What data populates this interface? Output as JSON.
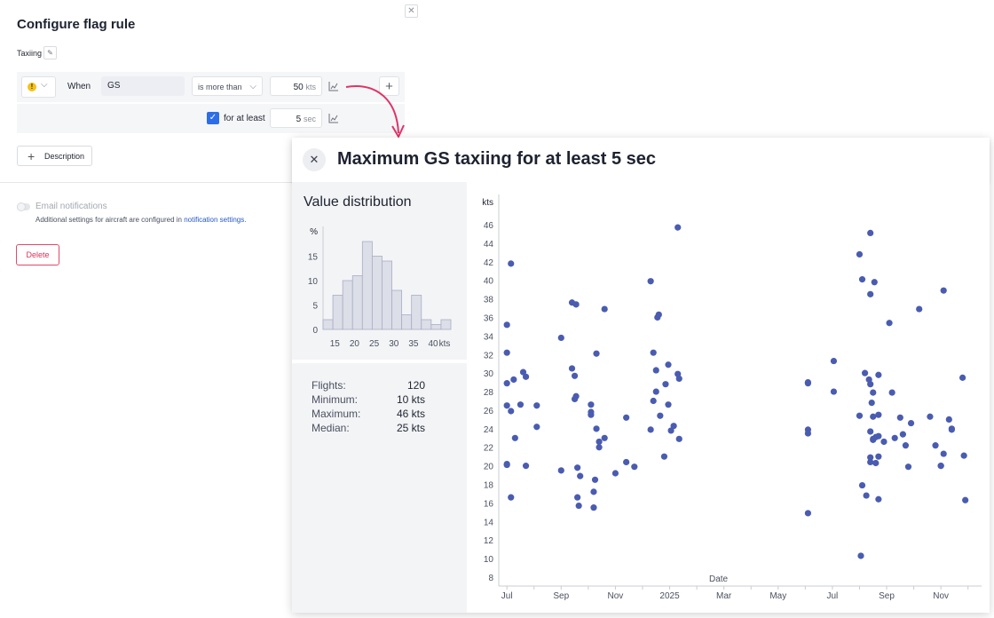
{
  "form": {
    "title": "Configure flag rule",
    "name": "Taxiing",
    "when_label": "When",
    "parameter": "GS",
    "condition": "is more than",
    "threshold_value": "50",
    "threshold_unit": "kts",
    "duration_label": "for at least",
    "duration_value": "5",
    "duration_unit": "sec",
    "description_button": "Description",
    "email_label": "Email notifications",
    "additional_text": "Additional settings for aircraft are configured in ",
    "notification_link": "notification settings.",
    "delete_button": "Delete",
    "accent_color": "#2d6ee6",
    "delete_color": "#d8335a"
  },
  "panel": {
    "title": "Maximum GS taxiing for at least 5 sec",
    "close_icon": "close-icon",
    "distribution_title": "Value distribution",
    "stats": [
      {
        "label": "Flights:",
        "value": "120"
      },
      {
        "label": "Minimum:",
        "value": "10 kts"
      },
      {
        "label": "Maximum:",
        "value": "46 kts"
      },
      {
        "label": "Median:",
        "value": "25 kts"
      }
    ]
  },
  "chart_data": [
    {
      "type": "bar",
      "ylabel": "%",
      "xlabel": "kts",
      "x_ticks": [
        "15",
        "20",
        "25",
        "30",
        "35",
        "40"
      ],
      "y_ticks": [
        0,
        5,
        10,
        15
      ],
      "ylim": [
        0,
        20
      ],
      "bins": [
        {
          "from": 12,
          "to": 14.5,
          "value": 2
        },
        {
          "from": 14.5,
          "to": 17,
          "value": 7
        },
        {
          "from": 17,
          "to": 19.5,
          "value": 10
        },
        {
          "from": 19.5,
          "to": 22,
          "value": 11
        },
        {
          "from": 22,
          "to": 24.5,
          "value": 18
        },
        {
          "from": 24.5,
          "to": 27,
          "value": 15
        },
        {
          "from": 27,
          "to": 29.5,
          "value": 14
        },
        {
          "from": 29.5,
          "to": 32,
          "value": 8
        },
        {
          "from": 32,
          "to": 34.5,
          "value": 3
        },
        {
          "from": 34.5,
          "to": 37,
          "value": 7
        },
        {
          "from": 37,
          "to": 39.5,
          "value": 2
        },
        {
          "from": 39.5,
          "to": 42,
          "value": 1
        },
        {
          "from": 42,
          "to": 44.5,
          "value": 2
        }
      ],
      "bar_color": "#dcdee8",
      "bar_stroke": "#a9adc4"
    },
    {
      "type": "scatter",
      "ylabel": "kts",
      "xlabel": "Date",
      "ylim": [
        8,
        46
      ],
      "y_ticks": [
        8,
        10,
        12,
        14,
        16,
        18,
        20,
        22,
        24,
        26,
        28,
        30,
        32,
        34,
        36,
        38,
        40,
        42,
        44,
        46
      ],
      "x_ticks": [
        "Jul",
        "Sep",
        "Nov",
        "2025",
        "Mar",
        "May",
        "Jul",
        "Sep",
        "Nov"
      ],
      "x_tick_months": [
        0,
        2,
        4,
        6,
        8,
        10,
        12,
        14,
        16
      ],
      "xlim": [
        -0.3,
        17.5
      ],
      "point_color": "#4a5cb0",
      "points": [
        [
          0.0,
          35.2
        ],
        [
          0.0,
          32.2
        ],
        [
          0.0,
          28.9
        ],
        [
          0.0,
          26.5
        ],
        [
          0.0,
          20.1
        ],
        [
          0.0,
          20.2
        ],
        [
          0.15,
          41.8
        ],
        [
          0.15,
          16.6
        ],
        [
          0.15,
          25.9
        ],
        [
          0.25,
          29.3
        ],
        [
          0.3,
          23.0
        ],
        [
          0.5,
          26.6
        ],
        [
          0.6,
          30.1
        ],
        [
          0.7,
          29.6
        ],
        [
          0.7,
          20.0
        ],
        [
          1.1,
          26.5
        ],
        [
          1.1,
          24.2
        ],
        [
          2.0,
          33.8
        ],
        [
          2.0,
          19.5
        ],
        [
          2.4,
          37.6
        ],
        [
          2.4,
          30.5
        ],
        [
          2.55,
          37.4
        ],
        [
          2.5,
          29.7
        ],
        [
          2.5,
          27.2
        ],
        [
          2.55,
          27.5
        ],
        [
          2.6,
          19.8
        ],
        [
          2.6,
          16.6
        ],
        [
          2.65,
          15.7
        ],
        [
          2.7,
          18.9
        ],
        [
          3.1,
          26.6
        ],
        [
          3.1,
          25.8
        ],
        [
          3.1,
          25.5
        ],
        [
          3.2,
          17.2
        ],
        [
          3.2,
          15.5
        ],
        [
          3.25,
          18.5
        ],
        [
          3.3,
          32.1
        ],
        [
          3.3,
          24.0
        ],
        [
          3.4,
          22.6
        ],
        [
          3.4,
          22.0
        ],
        [
          3.6,
          36.9
        ],
        [
          3.6,
          23.0
        ],
        [
          4.0,
          19.2
        ],
        [
          4.4,
          25.2
        ],
        [
          4.4,
          20.4
        ],
        [
          4.7,
          19.9
        ],
        [
          5.3,
          39.9
        ],
        [
          5.4,
          32.2
        ],
        [
          5.4,
          27.0
        ],
        [
          5.3,
          23.9
        ],
        [
          5.5,
          30.3
        ],
        [
          5.5,
          28.0
        ],
        [
          5.55,
          36.0
        ],
        [
          5.6,
          36.3
        ],
        [
          5.65,
          25.4
        ],
        [
          5.8,
          21.0
        ],
        [
          5.85,
          28.8
        ],
        [
          5.95,
          30.9
        ],
        [
          5.95,
          26.6
        ],
        [
          6.05,
          23.8
        ],
        [
          6.15,
          24.3
        ],
        [
          6.3,
          29.9
        ],
        [
          6.35,
          29.4
        ],
        [
          6.35,
          22.9
        ],
        [
          6.3,
          45.7
        ],
        [
          11.1,
          29.0
        ],
        [
          11.1,
          28.9
        ],
        [
          11.1,
          23.5
        ],
        [
          11.1,
          23.9
        ],
        [
          11.1,
          14.9
        ],
        [
          12.05,
          31.3
        ],
        [
          12.05,
          28.0
        ],
        [
          13.0,
          42.8
        ],
        [
          13.1,
          40.1
        ],
        [
          13.0,
          25.4
        ],
        [
          13.1,
          17.9
        ],
        [
          13.05,
          10.3
        ],
        [
          13.2,
          30.0
        ],
        [
          13.25,
          16.8
        ],
        [
          13.4,
          45.1
        ],
        [
          13.4,
          38.5
        ],
        [
          13.35,
          29.3
        ],
        [
          13.4,
          28.8
        ],
        [
          13.5,
          27.9
        ],
        [
          13.5,
          25.3
        ],
        [
          13.4,
          23.7
        ],
        [
          13.5,
          22.9
        ],
        [
          13.4,
          20.9
        ],
        [
          13.4,
          20.4
        ],
        [
          13.55,
          39.8
        ],
        [
          13.7,
          29.8
        ],
        [
          13.7,
          25.5
        ],
        [
          13.7,
          23.2
        ],
        [
          13.7,
          21.0
        ],
        [
          13.6,
          20.3
        ],
        [
          13.7,
          16.4
        ],
        [
          13.45,
          26.8
        ],
        [
          13.5,
          22.8
        ],
        [
          13.9,
          22.6
        ],
        [
          14.1,
          35.4
        ],
        [
          14.2,
          27.9
        ],
        [
          14.3,
          23.0
        ],
        [
          14.5,
          25.2
        ],
        [
          14.6,
          23.4
        ],
        [
          14.7,
          22.2
        ],
        [
          14.8,
          19.9
        ],
        [
          14.9,
          24.6
        ],
        [
          15.2,
          36.9
        ],
        [
          15.6,
          25.3
        ],
        [
          15.8,
          22.2
        ],
        [
          16.1,
          38.9
        ],
        [
          16.0,
          20.0
        ],
        [
          16.0,
          20.0
        ],
        [
          16.1,
          21.3
        ],
        [
          16.3,
          25.0
        ],
        [
          16.4,
          24.0
        ],
        [
          16.4,
          23.9
        ],
        [
          16.8,
          29.5
        ],
        [
          16.85,
          21.1
        ],
        [
          16.9,
          16.3
        ],
        [
          13.6,
          23.1
        ]
      ]
    }
  ]
}
